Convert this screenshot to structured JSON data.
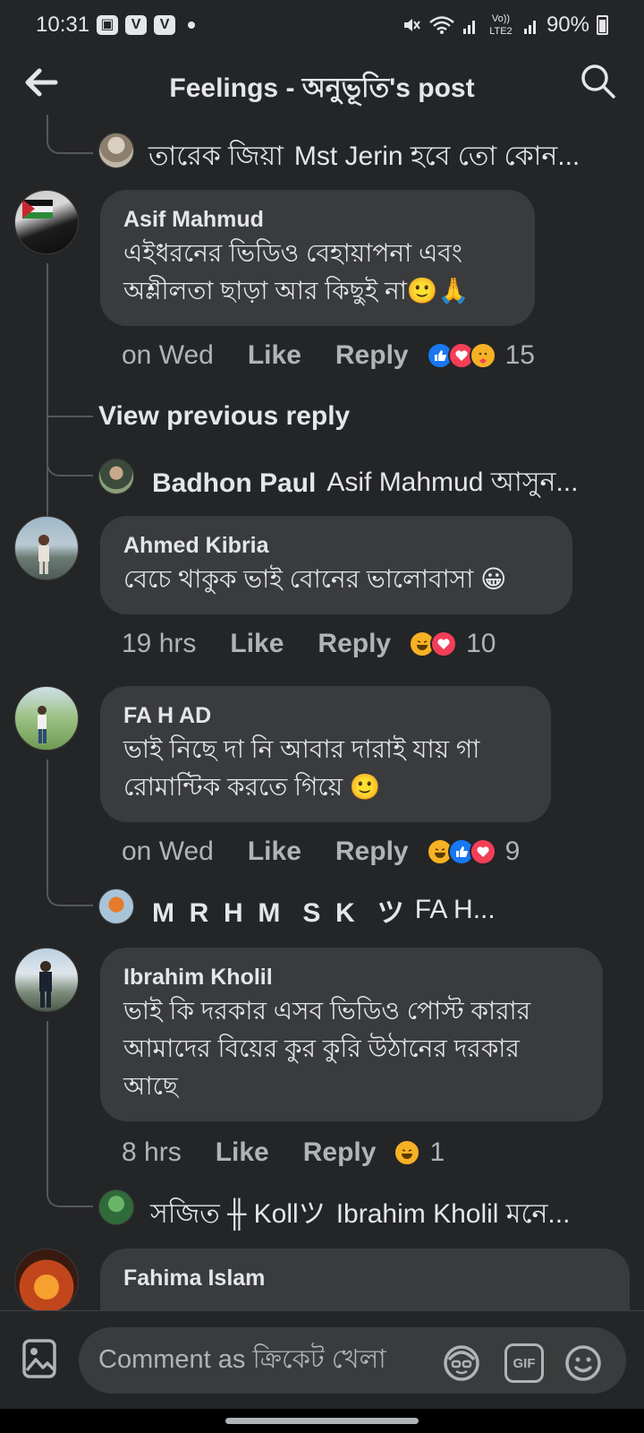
{
  "status_bar": {
    "time": "10:31",
    "badges": [
      "▣",
      "V",
      "V"
    ],
    "network": "Vo)) LTE2",
    "battery": "90%"
  },
  "header": {
    "title": "Feelings - অনুভূতি's post",
    "back_icon": "arrow-left-icon",
    "search_icon": "search-icon"
  },
  "comments": [
    {
      "type": "reply-preview",
      "name": "তারেক জিয়া",
      "text": "Mst Jerin হবে তো কোন..."
    },
    {
      "type": "comment",
      "name": "Asif Mahmud",
      "lines": [
        "এইধরনের ভিডিও বেহায়াপনা এবং",
        "অশ্লীলতা ছাড়া আর কিছুই না🙂🙏"
      ],
      "time": "on Wed",
      "like": "Like",
      "reply": "Reply",
      "reactions": [
        "like",
        "love",
        "care"
      ],
      "count": "15"
    },
    {
      "type": "view-previous",
      "label": "View previous reply"
    },
    {
      "type": "reply-preview",
      "name": "Badhon Paul",
      "text": "Asif Mahmud আসুন..."
    },
    {
      "type": "comment",
      "name": "Ahmed Kibria",
      "lines": [
        "বেচে থাকুক ভাই বোনের ভালোবাসা 😀"
      ],
      "time": "19 hrs",
      "like": "Like",
      "reply": "Reply",
      "reactions": [
        "haha",
        "love"
      ],
      "count": "10"
    },
    {
      "type": "comment",
      "name": "FA H AD",
      "lines": [
        "ভাই নিছে দা নি আবার  দারাই যায় গা",
        "রোমান্টিক করতে গিয়ে 🙂"
      ],
      "time": "on Wed",
      "like": "Like",
      "reply": "Reply",
      "reactions": [
        "haha",
        "like",
        "love"
      ],
      "count": "9"
    },
    {
      "type": "reply-preview",
      "name": "M  R  H  M   S  K   ツ",
      "text": "FA H..."
    },
    {
      "type": "comment",
      "name": "Ibrahim Kholil",
      "lines": [
        "ভাই কি দরকার এসব ভিডিও পোস্ট কারার",
        "আমাদের বিয়ের কুর কুরি উঠানের দরকার",
        "আছে"
      ],
      "time": "8 hrs",
      "like": "Like",
      "reply": "Reply",
      "reactions": [
        "haha"
      ],
      "count": "1"
    },
    {
      "type": "reply-preview",
      "name": "সজিত ╫ Kollツ",
      "text": "Ibrahim Kholil মনে..."
    },
    {
      "type": "comment-partial",
      "name": "Fahima Islam"
    }
  ],
  "composer": {
    "placeholder": "Comment as ক্রিকেট খেলা",
    "photo_icon": "photo-icon",
    "avatar_icon": "avatar-sticker-icon",
    "gif_label": "GIF",
    "emoji_icon": "emoji-icon"
  },
  "colors": {
    "background": "#242527",
    "bubble": "#3a3b3c",
    "text": "#e4e6eb",
    "muted": "#b0b3b8",
    "like_blue": "#1877f2",
    "love_red": "#f33e58",
    "emoji_yellow": "#f7b125"
  }
}
